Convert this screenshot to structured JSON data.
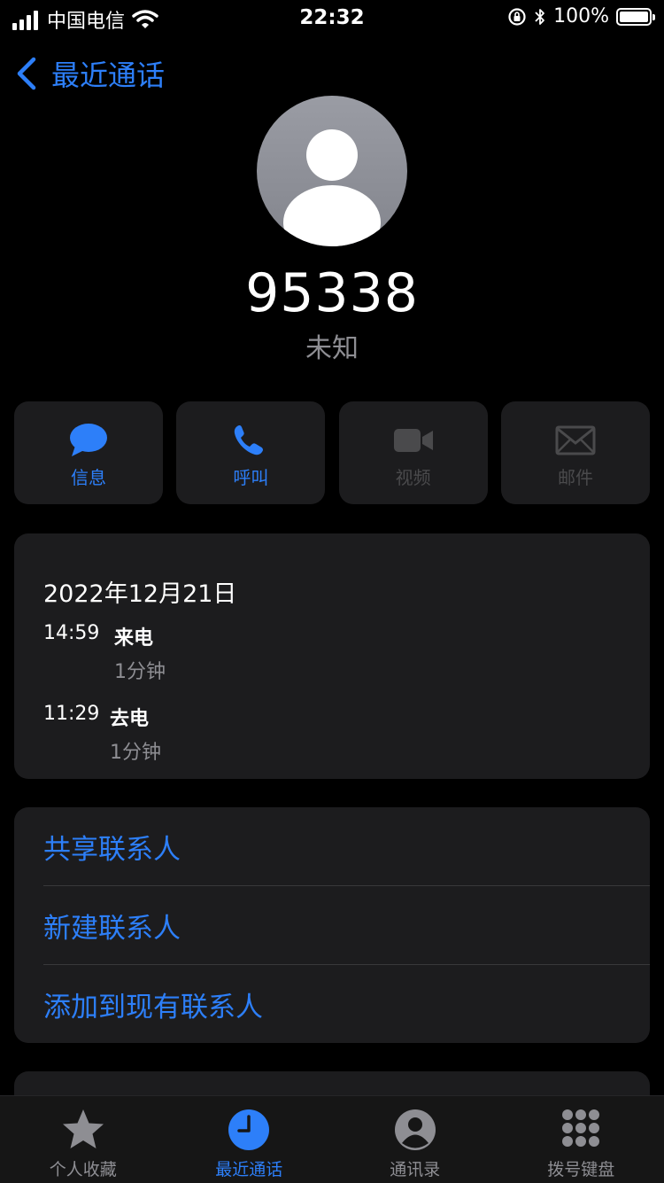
{
  "status_bar": {
    "carrier": "中国电信",
    "time": "22:32",
    "battery_percent": "100%",
    "battery_level": 1.0
  },
  "nav": {
    "back_label": "最近通话"
  },
  "contact": {
    "number": "95338",
    "subtitle": "未知"
  },
  "actions": [
    {
      "label": "信息",
      "icon": "message-icon",
      "enabled": true
    },
    {
      "label": "呼叫",
      "icon": "phone-icon",
      "enabled": true
    },
    {
      "label": "视频",
      "icon": "video-icon",
      "enabled": false
    },
    {
      "label": "邮件",
      "icon": "mail-icon",
      "enabled": false
    }
  ],
  "history": {
    "date": "2022年12月21日",
    "calls": [
      {
        "time": "14:59",
        "type": "来电",
        "duration": "1分钟"
      },
      {
        "time": "11:29",
        "type": "去电",
        "duration": "1分钟"
      }
    ]
  },
  "options": [
    {
      "label": "共享联系人"
    },
    {
      "label": "新建联系人"
    },
    {
      "label": "添加到现有联系人"
    }
  ],
  "tabbar": [
    {
      "label": "个人收藏",
      "icon": "star-icon",
      "active": false
    },
    {
      "label": "最近通话",
      "icon": "clock-icon",
      "active": true
    },
    {
      "label": "通讯录",
      "icon": "contacts-icon",
      "active": false
    },
    {
      "label": "拨号键盘",
      "icon": "keypad-icon",
      "active": false
    }
  ],
  "colors": {
    "accent": "#2d7ff9",
    "background": "#000000",
    "card": "#1c1c1e",
    "secondary_text": "#8e8e93",
    "disabled": "#4a4a4c"
  }
}
